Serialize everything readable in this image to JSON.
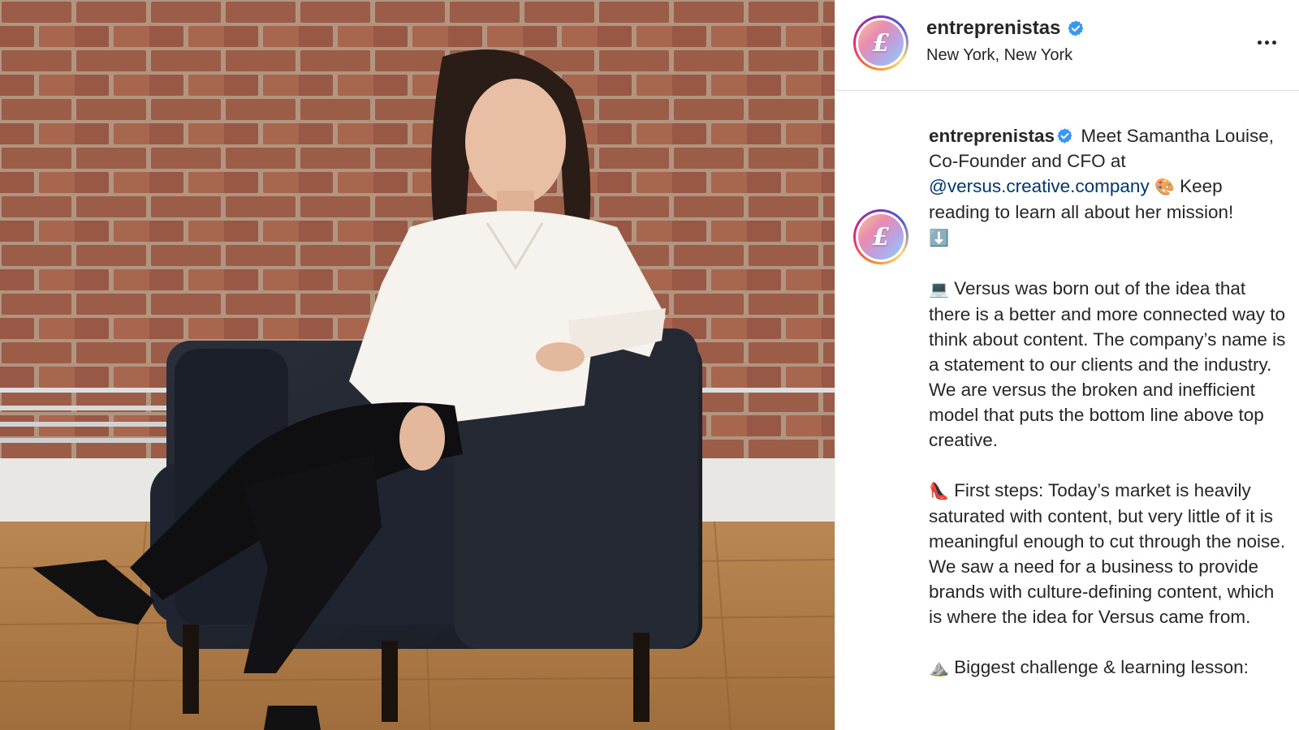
{
  "post": {
    "account": {
      "username": "entreprenistas",
      "location": "New York, New York",
      "verified": true,
      "avatar_letter": "£"
    },
    "more_icon": "more-horizontal-icon",
    "caption": {
      "intro_part1": "Meet Samantha Louise, Co-Founder and CFO at",
      "mention": "@versus.creative.company",
      "intro_part2": "Keep reading to learn all about her mission!",
      "emoji_palette": "🎨",
      "emoji_down": "⬇️",
      "para1_emoji": "💻",
      "para1": "Versus was born out of the idea that there is a better and more connected way to think about content. The company’s name is a statement to our clients and the industry. We are versus the broken and inefficient model that puts the bottom line above top creative.",
      "para2_emoji": "👠",
      "para2": "First steps: Today’s market is heavily saturated with content, but very little of it is meaningful enough to cut through the noise. We saw a need for a business to provide brands with culture-defining content, which is where the idea for Versus came from.",
      "para3_emoji": "⛰️",
      "para3": "Biggest challenge & learning lesson:"
    }
  },
  "colors": {
    "mention": "#00376b",
    "verified": "#3897f0",
    "divider": "#dbdbdb"
  }
}
